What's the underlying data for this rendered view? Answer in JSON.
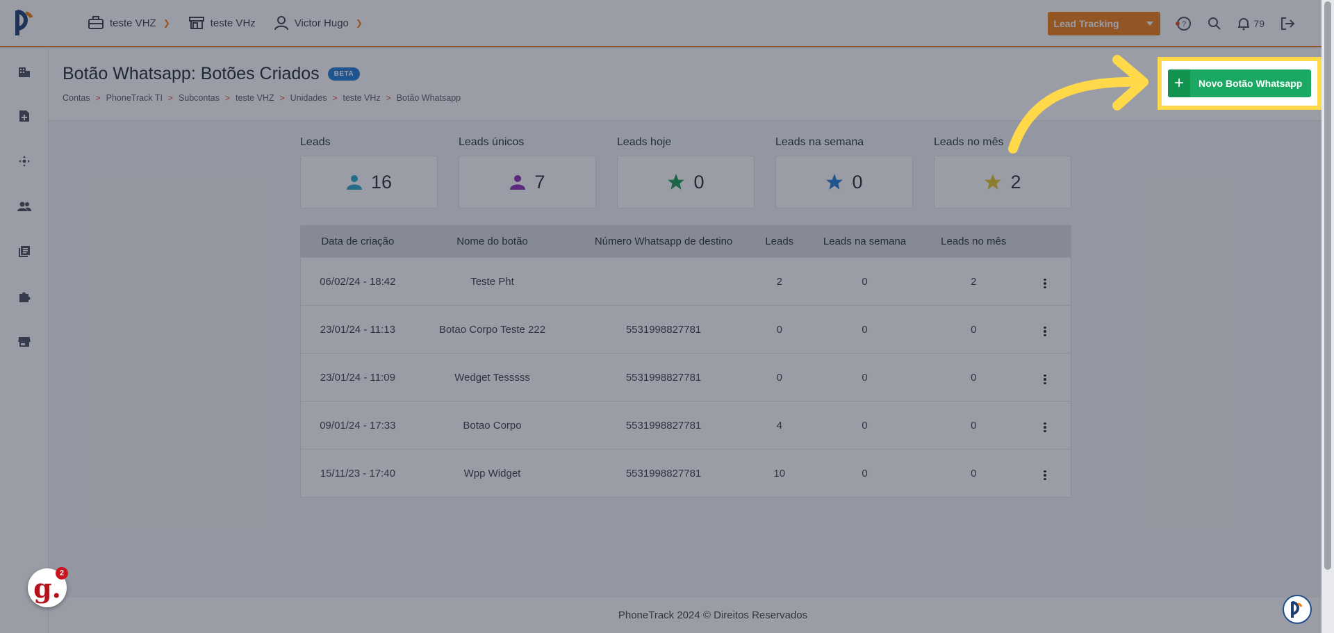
{
  "topbar": {
    "account": "teste VHZ",
    "store": "teste VHz",
    "user": "Victor Hugo",
    "lead_tracking": "Lead Tracking",
    "notifications": "79",
    "accent": "#f07c14"
  },
  "page": {
    "title": "Botão Whatsapp: Botões Criados",
    "badge": "BETA",
    "breadcrumb": [
      "Contas",
      "PhoneTrack TI",
      "Subcontas",
      "teste VHZ",
      "Unidades",
      "teste VHz",
      "Botão Whatsapp"
    ],
    "new_button": "Novo Botão Whatsapp"
  },
  "stats": [
    {
      "label": "Leads",
      "value": "16",
      "icon": "person-icon",
      "color": "#2aa7c9"
    },
    {
      "label": "Leads únicos",
      "value": "7",
      "icon": "person-icon",
      "color": "#8e2bb8"
    },
    {
      "label": "Leads hoje",
      "value": "0",
      "icon": "star-icon",
      "color": "#1a9a57"
    },
    {
      "label": "Leads na semana",
      "value": "0",
      "icon": "star-icon",
      "color": "#1f7bd8"
    },
    {
      "label": "Leads no mês",
      "value": "2",
      "icon": "star-icon",
      "color": "#e8c52a"
    }
  ],
  "table": {
    "headers": [
      "Data de criação",
      "Nome do botão",
      "Número Whatsapp de destino",
      "Leads",
      "Leads na semana",
      "Leads no mês"
    ],
    "rows": [
      [
        "06/02/24 - 18:42",
        "Teste Pht",
        "",
        "2",
        "0",
        "2"
      ],
      [
        "23/01/24 - 11:13",
        "Botao Corpo Teste 222",
        "5531998827781",
        "0",
        "0",
        "0"
      ],
      [
        "23/01/24 - 11:09",
        "Wedget Tesssss",
        "5531998827781",
        "0",
        "0",
        "0"
      ],
      [
        "09/01/24 - 17:33",
        "Botao Corpo",
        "5531998827781",
        "4",
        "0",
        "0"
      ],
      [
        "15/11/23 - 17:40",
        "Wpp Widget",
        "5531998827781",
        "10",
        "0",
        "0"
      ]
    ]
  },
  "footer": "PhoneTrack 2024 © Direitos Reservados",
  "g_badge": {
    "letter": "g.",
    "count": "2"
  }
}
